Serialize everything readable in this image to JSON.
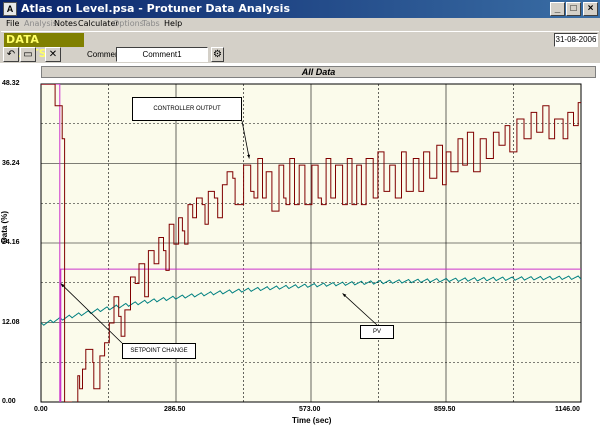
{
  "window": {
    "title": "Atlas on Level.psa - Protuner Data Analysis",
    "icon": "app-chart-icon",
    "controls": [
      "minimize-icon",
      "maximize-icon",
      "close-icon"
    ]
  },
  "menu": [
    {
      "label": "File",
      "enabled": true
    },
    {
      "label": "Analysis",
      "enabled": false
    },
    {
      "label": "Notes",
      "enabled": true
    },
    {
      "label": "Calculater",
      "enabled": true
    },
    {
      "label": "Options",
      "enabled": false
    },
    {
      "label": "Tabs",
      "enabled": false
    },
    {
      "label": "Help",
      "enabled": true
    }
  ],
  "banner": {
    "section_title": "DATA PLOTS",
    "date": "31-08-2006"
  },
  "toolbar": {
    "buttons": [
      "undo-icon",
      "open-folder-icon",
      "delete-icon"
    ],
    "comment_label": "Comment",
    "comment_value": "Comment1",
    "comment_tool_icon": "settings-icon"
  },
  "chart_data": {
    "type": "line",
    "title": "All Data",
    "xlabel": "Time (sec)",
    "ylabel": "Data (%)",
    "xlim": [
      0,
      1146
    ],
    "ylim": [
      0,
      48.32
    ],
    "x_ticks": [
      "0.00",
      "286.50",
      "573.00",
      "859.50",
      "1146.00"
    ],
    "y_ticks": [
      "0.00",
      "12.08",
      "24.16",
      "36.24",
      "48.32"
    ],
    "grid": true,
    "colors": {
      "controller_output": "#800000",
      "setpoint": "#cc33cc",
      "pv": "#008080",
      "plot_background": "#fbfbeb"
    },
    "series": [
      {
        "name": "CONTROLLER OUTPUT",
        "points": [
          [
            0,
            48.3
          ],
          [
            30,
            48.3
          ],
          [
            30,
            45
          ],
          [
            45,
            45
          ],
          [
            45,
            40
          ],
          [
            50,
            40
          ],
          [
            50,
            0
          ],
          [
            65,
            0
          ],
          [
            65,
            -3
          ],
          [
            78,
            -3
          ],
          [
            78,
            4
          ],
          [
            82,
            4
          ],
          [
            82,
            2
          ],
          [
            88,
            2
          ],
          [
            88,
            5
          ],
          [
            95,
            5
          ],
          [
            95,
            8
          ],
          [
            110,
            8
          ],
          [
            110,
            6
          ],
          [
            112,
            6
          ],
          [
            112,
            2
          ],
          [
            125,
            2
          ],
          [
            125,
            7
          ],
          [
            135,
            7
          ],
          [
            135,
            9
          ],
          [
            145,
            9
          ],
          [
            145,
            12
          ],
          [
            155,
            12
          ],
          [
            155,
            16
          ],
          [
            165,
            16
          ],
          [
            165,
            13
          ],
          [
            170,
            13
          ],
          [
            170,
            10
          ],
          [
            178,
            10
          ],
          [
            178,
            14
          ],
          [
            190,
            14
          ],
          [
            190,
            19
          ],
          [
            200,
            19
          ],
          [
            200,
            18
          ],
          [
            208,
            18
          ],
          [
            208,
            21
          ],
          [
            220,
            21
          ],
          [
            220,
            16
          ],
          [
            228,
            16
          ],
          [
            228,
            23
          ],
          [
            240,
            23
          ],
          [
            240,
            21
          ],
          [
            250,
            21
          ],
          [
            250,
            25
          ],
          [
            260,
            25
          ],
          [
            260,
            23
          ],
          [
            265,
            23
          ],
          [
            265,
            20
          ],
          [
            272,
            20
          ],
          [
            272,
            27
          ],
          [
            282,
            27
          ],
          [
            282,
            24
          ],
          [
            292,
            24
          ],
          [
            292,
            28
          ],
          [
            300,
            28
          ],
          [
            300,
            26
          ],
          [
            305,
            26
          ],
          [
            305,
            24
          ],
          [
            312,
            24
          ],
          [
            312,
            30
          ],
          [
            322,
            30
          ],
          [
            322,
            28
          ],
          [
            330,
            28
          ],
          [
            330,
            31
          ],
          [
            342,
            31
          ],
          [
            342,
            30
          ],
          [
            348,
            30
          ],
          [
            348,
            27
          ],
          [
            355,
            27
          ],
          [
            355,
            32
          ],
          [
            368,
            32
          ],
          [
            368,
            31
          ],
          [
            375,
            31
          ],
          [
            375,
            28
          ],
          [
            385,
            28
          ],
          [
            385,
            33
          ],
          [
            395,
            33
          ],
          [
            395,
            35
          ],
          [
            407,
            35
          ],
          [
            407,
            34
          ],
          [
            412,
            34
          ],
          [
            412,
            30
          ],
          [
            430,
            30
          ],
          [
            430,
            36
          ],
          [
            445,
            36
          ],
          [
            445,
            32
          ],
          [
            452,
            32
          ],
          [
            452,
            31
          ],
          [
            460,
            31
          ],
          [
            460,
            37
          ],
          [
            470,
            37
          ],
          [
            470,
            31
          ],
          [
            478,
            31
          ],
          [
            478,
            35
          ],
          [
            490,
            35
          ],
          [
            490,
            29
          ],
          [
            505,
            29
          ],
          [
            505,
            36
          ],
          [
            515,
            36
          ],
          [
            515,
            31
          ],
          [
            520,
            31
          ],
          [
            520,
            30
          ],
          [
            528,
            30
          ],
          [
            528,
            37
          ],
          [
            538,
            37
          ],
          [
            538,
            30
          ],
          [
            548,
            30
          ],
          [
            548,
            36
          ],
          [
            560,
            36
          ],
          [
            560,
            30
          ],
          [
            575,
            30
          ],
          [
            575,
            36
          ],
          [
            588,
            36
          ],
          [
            588,
            31
          ],
          [
            595,
            31
          ],
          [
            595,
            30
          ],
          [
            605,
            30
          ],
          [
            605,
            37
          ],
          [
            615,
            37
          ],
          [
            615,
            31
          ],
          [
            625,
            31
          ],
          [
            625,
            36
          ],
          [
            640,
            36
          ],
          [
            640,
            30
          ],
          [
            650,
            30
          ],
          [
            650,
            37
          ],
          [
            660,
            37
          ],
          [
            660,
            30
          ],
          [
            670,
            30
          ],
          [
            670,
            36
          ],
          [
            680,
            36
          ],
          [
            680,
            30
          ],
          [
            690,
            30
          ],
          [
            690,
            37
          ],
          [
            705,
            37
          ],
          [
            705,
            31
          ],
          [
            715,
            31
          ],
          [
            715,
            38
          ],
          [
            728,
            38
          ],
          [
            728,
            32
          ],
          [
            740,
            32
          ],
          [
            740,
            36
          ],
          [
            752,
            36
          ],
          [
            752,
            31
          ],
          [
            765,
            31
          ],
          [
            765,
            38
          ],
          [
            775,
            38
          ],
          [
            775,
            32
          ],
          [
            790,
            32
          ],
          [
            790,
            37
          ],
          [
            802,
            37
          ],
          [
            802,
            32
          ],
          [
            812,
            32
          ],
          [
            812,
            38
          ],
          [
            825,
            38
          ],
          [
            825,
            34
          ],
          [
            840,
            34
          ],
          [
            840,
            39
          ],
          [
            852,
            39
          ],
          [
            852,
            33
          ],
          [
            860,
            33
          ],
          [
            860,
            38
          ],
          [
            870,
            38
          ],
          [
            870,
            35
          ],
          [
            885,
            35
          ],
          [
            885,
            40
          ],
          [
            895,
            40
          ],
          [
            895,
            36
          ],
          [
            905,
            36
          ],
          [
            905,
            41
          ],
          [
            918,
            41
          ],
          [
            918,
            35
          ],
          [
            932,
            35
          ],
          [
            932,
            40
          ],
          [
            945,
            40
          ],
          [
            945,
            37
          ],
          [
            960,
            37
          ],
          [
            960,
            41
          ],
          [
            972,
            41
          ],
          [
            972,
            39
          ],
          [
            985,
            39
          ],
          [
            985,
            42
          ],
          [
            995,
            42
          ],
          [
            995,
            38
          ],
          [
            1010,
            38
          ],
          [
            1010,
            43
          ],
          [
            1025,
            43
          ],
          [
            1025,
            40
          ],
          [
            1040,
            40
          ],
          [
            1040,
            44
          ],
          [
            1052,
            44
          ],
          [
            1052,
            41
          ],
          [
            1065,
            41
          ],
          [
            1065,
            45
          ],
          [
            1078,
            45
          ],
          [
            1078,
            40
          ],
          [
            1090,
            40
          ],
          [
            1090,
            43
          ],
          [
            1108,
            43
          ],
          [
            1108,
            40
          ],
          [
            1118,
            40
          ],
          [
            1118,
            44
          ],
          [
            1130,
            44
          ],
          [
            1130,
            42
          ],
          [
            1140,
            42
          ],
          [
            1140,
            45.5
          ],
          [
            1146,
            45.5
          ]
        ]
      },
      {
        "name": "SETPOINT",
        "points": [
          [
            0,
            48.3
          ],
          [
            40,
            48.3
          ],
          [
            40,
            0
          ],
          [
            42,
            0
          ],
          [
            42,
            20.2
          ],
          [
            1146,
            20.2
          ]
        ]
      },
      {
        "name": "PV",
        "x_start": 0,
        "x_end": 1146,
        "y_start": 11.8,
        "y_end": 18.9,
        "curve": "rising-saturating-with-ripple",
        "ripple_amplitude": 0.5,
        "ripple_period": 20
      }
    ],
    "annotations": [
      {
        "text": "CONTROLLER OUTPUT",
        "target": [
          442,
          37
        ]
      },
      {
        "text": "SETPOINT CHANGE",
        "target": [
          42,
          18
        ]
      },
      {
        "text": "PV",
        "target": [
          640,
          16.5
        ]
      }
    ]
  }
}
